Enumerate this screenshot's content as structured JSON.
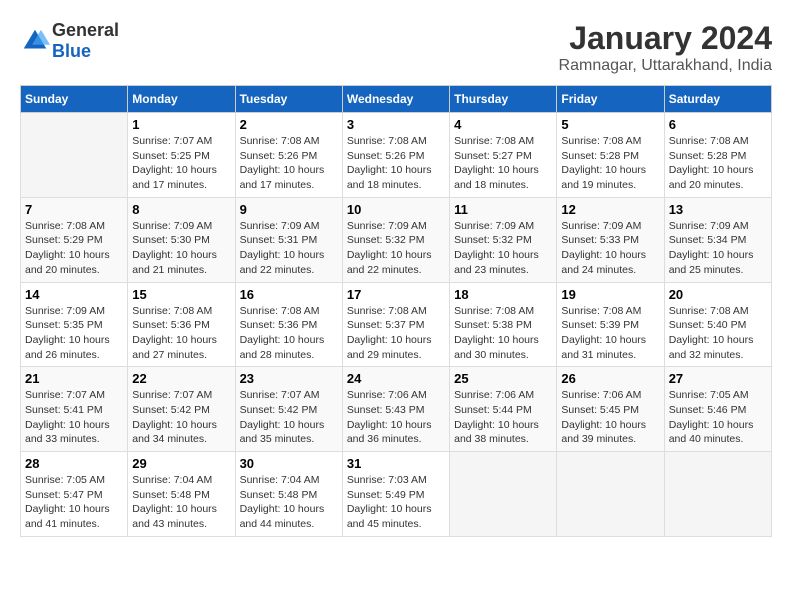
{
  "header": {
    "logo_general": "General",
    "logo_blue": "Blue",
    "title": "January 2024",
    "subtitle": "Ramnagar, Uttarakhand, India"
  },
  "calendar": {
    "days_of_week": [
      "Sunday",
      "Monday",
      "Tuesday",
      "Wednesday",
      "Thursday",
      "Friday",
      "Saturday"
    ],
    "weeks": [
      [
        {
          "day": "",
          "sunrise": "",
          "sunset": "",
          "daylight": ""
        },
        {
          "day": "1",
          "sunrise": "Sunrise: 7:07 AM",
          "sunset": "Sunset: 5:25 PM",
          "daylight": "Daylight: 10 hours and 17 minutes."
        },
        {
          "day": "2",
          "sunrise": "Sunrise: 7:08 AM",
          "sunset": "Sunset: 5:26 PM",
          "daylight": "Daylight: 10 hours and 17 minutes."
        },
        {
          "day": "3",
          "sunrise": "Sunrise: 7:08 AM",
          "sunset": "Sunset: 5:26 PM",
          "daylight": "Daylight: 10 hours and 18 minutes."
        },
        {
          "day": "4",
          "sunrise": "Sunrise: 7:08 AM",
          "sunset": "Sunset: 5:27 PM",
          "daylight": "Daylight: 10 hours and 18 minutes."
        },
        {
          "day": "5",
          "sunrise": "Sunrise: 7:08 AM",
          "sunset": "Sunset: 5:28 PM",
          "daylight": "Daylight: 10 hours and 19 minutes."
        },
        {
          "day": "6",
          "sunrise": "Sunrise: 7:08 AM",
          "sunset": "Sunset: 5:28 PM",
          "daylight": "Daylight: 10 hours and 20 minutes."
        }
      ],
      [
        {
          "day": "7",
          "sunrise": "Sunrise: 7:08 AM",
          "sunset": "Sunset: 5:29 PM",
          "daylight": "Daylight: 10 hours and 20 minutes."
        },
        {
          "day": "8",
          "sunrise": "Sunrise: 7:09 AM",
          "sunset": "Sunset: 5:30 PM",
          "daylight": "Daylight: 10 hours and 21 minutes."
        },
        {
          "day": "9",
          "sunrise": "Sunrise: 7:09 AM",
          "sunset": "Sunset: 5:31 PM",
          "daylight": "Daylight: 10 hours and 22 minutes."
        },
        {
          "day": "10",
          "sunrise": "Sunrise: 7:09 AM",
          "sunset": "Sunset: 5:32 PM",
          "daylight": "Daylight: 10 hours and 22 minutes."
        },
        {
          "day": "11",
          "sunrise": "Sunrise: 7:09 AM",
          "sunset": "Sunset: 5:32 PM",
          "daylight": "Daylight: 10 hours and 23 minutes."
        },
        {
          "day": "12",
          "sunrise": "Sunrise: 7:09 AM",
          "sunset": "Sunset: 5:33 PM",
          "daylight": "Daylight: 10 hours and 24 minutes."
        },
        {
          "day": "13",
          "sunrise": "Sunrise: 7:09 AM",
          "sunset": "Sunset: 5:34 PM",
          "daylight": "Daylight: 10 hours and 25 minutes."
        }
      ],
      [
        {
          "day": "14",
          "sunrise": "Sunrise: 7:09 AM",
          "sunset": "Sunset: 5:35 PM",
          "daylight": "Daylight: 10 hours and 26 minutes."
        },
        {
          "day": "15",
          "sunrise": "Sunrise: 7:08 AM",
          "sunset": "Sunset: 5:36 PM",
          "daylight": "Daylight: 10 hours and 27 minutes."
        },
        {
          "day": "16",
          "sunrise": "Sunrise: 7:08 AM",
          "sunset": "Sunset: 5:36 PM",
          "daylight": "Daylight: 10 hours and 28 minutes."
        },
        {
          "day": "17",
          "sunrise": "Sunrise: 7:08 AM",
          "sunset": "Sunset: 5:37 PM",
          "daylight": "Daylight: 10 hours and 29 minutes."
        },
        {
          "day": "18",
          "sunrise": "Sunrise: 7:08 AM",
          "sunset": "Sunset: 5:38 PM",
          "daylight": "Daylight: 10 hours and 30 minutes."
        },
        {
          "day": "19",
          "sunrise": "Sunrise: 7:08 AM",
          "sunset": "Sunset: 5:39 PM",
          "daylight": "Daylight: 10 hours and 31 minutes."
        },
        {
          "day": "20",
          "sunrise": "Sunrise: 7:08 AM",
          "sunset": "Sunset: 5:40 PM",
          "daylight": "Daylight: 10 hours and 32 minutes."
        }
      ],
      [
        {
          "day": "21",
          "sunrise": "Sunrise: 7:07 AM",
          "sunset": "Sunset: 5:41 PM",
          "daylight": "Daylight: 10 hours and 33 minutes."
        },
        {
          "day": "22",
          "sunrise": "Sunrise: 7:07 AM",
          "sunset": "Sunset: 5:42 PM",
          "daylight": "Daylight: 10 hours and 34 minutes."
        },
        {
          "day": "23",
          "sunrise": "Sunrise: 7:07 AM",
          "sunset": "Sunset: 5:42 PM",
          "daylight": "Daylight: 10 hours and 35 minutes."
        },
        {
          "day": "24",
          "sunrise": "Sunrise: 7:06 AM",
          "sunset": "Sunset: 5:43 PM",
          "daylight": "Daylight: 10 hours and 36 minutes."
        },
        {
          "day": "25",
          "sunrise": "Sunrise: 7:06 AM",
          "sunset": "Sunset: 5:44 PM",
          "daylight": "Daylight: 10 hours and 38 minutes."
        },
        {
          "day": "26",
          "sunrise": "Sunrise: 7:06 AM",
          "sunset": "Sunset: 5:45 PM",
          "daylight": "Daylight: 10 hours and 39 minutes."
        },
        {
          "day": "27",
          "sunrise": "Sunrise: 7:05 AM",
          "sunset": "Sunset: 5:46 PM",
          "daylight": "Daylight: 10 hours and 40 minutes."
        }
      ],
      [
        {
          "day": "28",
          "sunrise": "Sunrise: 7:05 AM",
          "sunset": "Sunset: 5:47 PM",
          "daylight": "Daylight: 10 hours and 41 minutes."
        },
        {
          "day": "29",
          "sunrise": "Sunrise: 7:04 AM",
          "sunset": "Sunset: 5:48 PM",
          "daylight": "Daylight: 10 hours and 43 minutes."
        },
        {
          "day": "30",
          "sunrise": "Sunrise: 7:04 AM",
          "sunset": "Sunset: 5:48 PM",
          "daylight": "Daylight: 10 hours and 44 minutes."
        },
        {
          "day": "31",
          "sunrise": "Sunrise: 7:03 AM",
          "sunset": "Sunset: 5:49 PM",
          "daylight": "Daylight: 10 hours and 45 minutes."
        },
        {
          "day": "",
          "sunrise": "",
          "sunset": "",
          "daylight": ""
        },
        {
          "day": "",
          "sunrise": "",
          "sunset": "",
          "daylight": ""
        },
        {
          "day": "",
          "sunrise": "",
          "sunset": "",
          "daylight": ""
        }
      ]
    ]
  }
}
